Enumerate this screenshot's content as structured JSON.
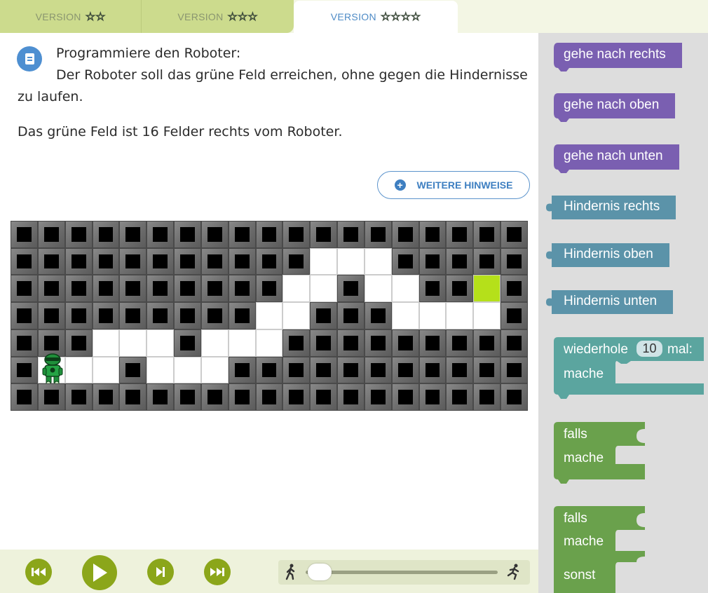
{
  "tabs": [
    {
      "label": "VERSION",
      "stars": "☆☆"
    },
    {
      "label": "VERSION",
      "stars": "☆☆☆"
    },
    {
      "label": "VERSION",
      "stars": "☆☆☆☆"
    }
  ],
  "task": {
    "line1": "Programmiere den Roboter:",
    "line2": "Der Roboter soll das grüne Feld erreichen, ohne gegen die Hindernisse",
    "line3": "zu laufen.",
    "line4": "Das grüne Feld ist 16 Felder rechts vom Roboter.",
    "icon": "document-icon"
  },
  "hints_button": {
    "label": "WEITERE HINWEISE",
    "icon": "plus-circle-icon"
  },
  "grid": {
    "rows": [
      "###################",
      "###########...#####",
      "##########..#..##G#",
      "#########..###....#",
      "###...#...#########",
      "#R..#...###########",
      "###################"
    ],
    "legend": {
      "#": "wall",
      ".": "free",
      "G": "goal",
      "R": "robot"
    }
  },
  "blocks": [
    {
      "label": "gehe nach rechts",
      "color": "#7a5fb1"
    },
    {
      "label": "gehe nach oben",
      "color": "#7a5fb1"
    },
    {
      "label": "gehe nach unten",
      "color": "#7a5fb1"
    },
    {
      "label": "Hindernis rechts",
      "color": "#5b93a9"
    },
    {
      "label": "Hindernis oben",
      "color": "#5b93a9"
    },
    {
      "label": "Hindernis unten",
      "color": "#5b93a9"
    }
  ],
  "repeat_block": {
    "prefix": "wiederhole",
    "count": "10",
    "suffix": "mal:",
    "do": "mache",
    "color": "#5ba59f"
  },
  "if_block": {
    "if": "falls",
    "do": "mache",
    "color": "#6aa14c"
  },
  "ifelse_block": {
    "if": "falls",
    "do": "mache",
    "else": "sonst",
    "color": "#6aa14c"
  },
  "controls": {
    "icons": [
      "skip-to-start-icon",
      "play-icon",
      "step-icon",
      "skip-to-end-icon"
    ],
    "speed": {
      "slow_icon": "walking-person-icon",
      "fast_icon": "running-person-icon",
      "value": 0.0
    }
  }
}
